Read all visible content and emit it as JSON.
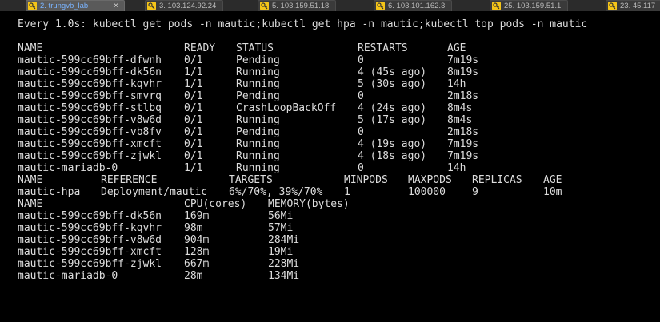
{
  "tabs": [
    {
      "label": "2. trungvb_lab",
      "active": true
    },
    {
      "label": "3. 103.124.92.24",
      "active": false
    },
    {
      "label": "5. 103.159.51.18",
      "active": false
    },
    {
      "label": "6. 103.101.162.3",
      "active": false
    },
    {
      "label": "25. 103.159.51.1",
      "active": false
    },
    {
      "label": "23. 45.117",
      "active": false
    }
  ],
  "watch_header": "Every 1.0s: kubectl get pods -n mautic;kubectl get hpa -n mautic;kubectl top pods -n mautic",
  "pods": {
    "headers": [
      "NAME",
      "READY",
      "STATUS",
      "RESTARTS",
      "AGE"
    ],
    "rows": [
      [
        "mautic-599cc69bff-dfwnh",
        "0/1",
        "Pending",
        "0",
        "7m19s"
      ],
      [
        "mautic-599cc69bff-dk56n",
        "1/1",
        "Running",
        "4 (45s ago)",
        "8m19s"
      ],
      [
        "mautic-599cc69bff-kqvhr",
        "1/1",
        "Running",
        "5 (30s ago)",
        "14h"
      ],
      [
        "mautic-599cc69bff-smvrq",
        "0/1",
        "Pending",
        "0",
        "2m18s"
      ],
      [
        "mautic-599cc69bff-stlbq",
        "0/1",
        "CrashLoopBackOff",
        "4 (24s ago)",
        "8m4s"
      ],
      [
        "mautic-599cc69bff-v8w6d",
        "0/1",
        "Running",
        "5 (17s ago)",
        "8m4s"
      ],
      [
        "mautic-599cc69bff-vb8fv",
        "0/1",
        "Pending",
        "0",
        "2m18s"
      ],
      [
        "mautic-599cc69bff-xmcft",
        "0/1",
        "Running",
        "4 (19s ago)",
        "7m19s"
      ],
      [
        "mautic-599cc69bff-zjwkl",
        "0/1",
        "Running",
        "4 (18s ago)",
        "7m19s"
      ],
      [
        "mautic-mariadb-0",
        "1/1",
        "Running",
        "0",
        "14h"
      ]
    ]
  },
  "hpa": {
    "headers": [
      "NAME",
      "REFERENCE",
      "TARGETS",
      "MINPODS",
      "MAXPODS",
      "REPLICAS",
      "AGE"
    ],
    "rows": [
      [
        "mautic-hpa",
        "Deployment/mautic",
        "6%/70%, 39%/70%",
        "1",
        "100000",
        "9",
        "10m"
      ]
    ]
  },
  "top": {
    "headers": [
      "NAME",
      "CPU(cores)",
      "MEMORY(bytes)"
    ],
    "rows": [
      [
        "mautic-599cc69bff-dk56n",
        "169m",
        "56Mi"
      ],
      [
        "mautic-599cc69bff-kqvhr",
        "98m",
        "57Mi"
      ],
      [
        "mautic-599cc69bff-v8w6d",
        "904m",
        "284Mi"
      ],
      [
        "mautic-599cc69bff-xmcft",
        "128m",
        "19Mi"
      ],
      [
        "mautic-599cc69bff-zjwkl",
        "667m",
        "228Mi"
      ],
      [
        "mautic-mariadb-0",
        "28m",
        "134Mi"
      ]
    ]
  }
}
